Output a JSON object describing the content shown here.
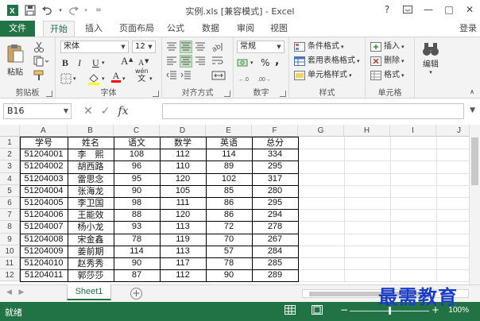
{
  "window": {
    "title": "实例.xls  [兼容模式] - Excel",
    "help": "?",
    "restore_ribbon": "□",
    "minimize": "—",
    "maximize": "□",
    "close": "✕"
  },
  "quick_access": {
    "icons": [
      "excel-logo-icon",
      "save-icon",
      "undo-icon",
      "redo-icon",
      "customize-icon"
    ]
  },
  "ribbon_tabs": {
    "file": "文件",
    "tabs": [
      "开始",
      "插入",
      "页面布局",
      "公式",
      "数据",
      "审阅",
      "视图"
    ],
    "active": "开始",
    "login": "登录"
  },
  "ribbon": {
    "clipboard": {
      "paste": "粘贴",
      "label": "剪贴板"
    },
    "font": {
      "name": "宋体",
      "size": "12",
      "bold": "B",
      "italic": "I",
      "underline": "U",
      "grow": "A",
      "shrink": "A",
      "phonetic": "wén",
      "font_color": "A",
      "label": "字体"
    },
    "alignment": {
      "label": "对齐方式"
    },
    "number": {
      "format": "常规",
      "percent": "%",
      "comma": ",",
      "label": "数字"
    },
    "styles": {
      "conditional": "条件格式",
      "table": "套用表格格式",
      "cell": "单元格样式",
      "label": "样式"
    },
    "cells": {
      "insert": "插入",
      "delete": "删除",
      "format": "格式",
      "label": "单元格"
    },
    "editing": {
      "label": "编辑"
    }
  },
  "formula_bar": {
    "name_box": "B16",
    "cancel": "✕",
    "enter": "✓",
    "fx": "fx",
    "content": ""
  },
  "sheet": {
    "columns": [
      "A",
      "B",
      "C",
      "D",
      "E",
      "F",
      "G",
      "H",
      "I",
      "J"
    ],
    "rows": [
      "1",
      "2",
      "3",
      "4",
      "5",
      "6",
      "7",
      "8",
      "9",
      "10",
      "11",
      "12"
    ],
    "data": [
      [
        "学号",
        "姓名",
        "语文",
        "数学",
        "英语",
        "总分"
      ],
      [
        "51204001",
        "李　熙",
        "108",
        "112",
        "114",
        "334"
      ],
      [
        "51204002",
        "胡西路",
        "96",
        "110",
        "89",
        "295"
      ],
      [
        "51204003",
        "雷思念",
        "95",
        "120",
        "102",
        "317"
      ],
      [
        "51204004",
        "张海龙",
        "90",
        "105",
        "85",
        "280"
      ],
      [
        "51204005",
        "李卫国",
        "98",
        "111",
        "86",
        "295"
      ],
      [
        "51204006",
        "王能效",
        "88",
        "120",
        "86",
        "294"
      ],
      [
        "51204007",
        "杨小龙",
        "93",
        "113",
        "72",
        "278"
      ],
      [
        "51204008",
        "宋金鑫",
        "78",
        "119",
        "70",
        "267"
      ],
      [
        "51204009",
        "姜前期",
        "114",
        "113",
        "57",
        "284"
      ],
      [
        "51204010",
        "赵秀秀",
        "90",
        "117",
        "78",
        "285"
      ],
      [
        "51204011",
        "郭莎莎",
        "87",
        "112",
        "90",
        "289"
      ]
    ]
  },
  "sheet_tabs": {
    "name": "Sheet1",
    "add": "+"
  },
  "status": {
    "text": "就绪",
    "zoom": "100%",
    "zoom_out": "−",
    "zoom_in": "+"
  },
  "watermark": "最需教育",
  "colors": {
    "excel_green": "#217346",
    "watermark": "#1a3cc8"
  }
}
